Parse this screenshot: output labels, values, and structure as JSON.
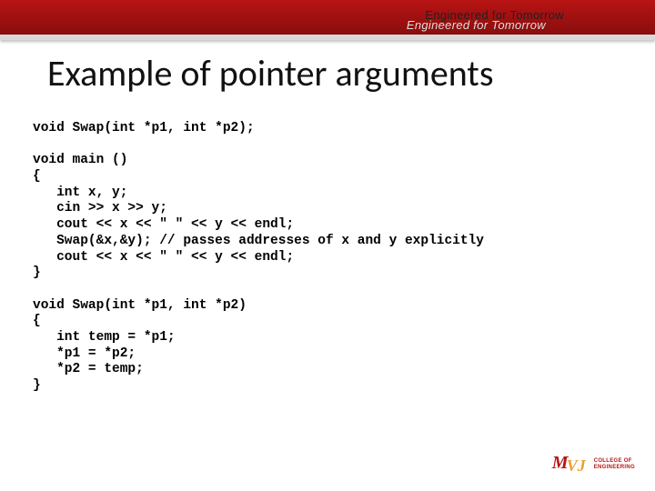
{
  "header": {
    "tagline": "Engineered for Tomorrow",
    "ghost_tagline": "Engineered for Tomorrow"
  },
  "slide": {
    "title": "Example of pointer arguments"
  },
  "code": {
    "line1": "void Swap(int *p1, int *p2);",
    "blank1": "",
    "line2": "void main ()",
    "line3": "{",
    "line4": "   int x, y;",
    "line5": "   cin >> x >> y;",
    "line6": "   cout << x << \" \" << y << endl;",
    "line7": "   Swap(&x,&y); // passes addresses of x and y explicitly",
    "line8": "   cout << x << \" \" << y << endl;",
    "line9": "}",
    "blank2": "",
    "line10": "void Swap(int *p1, int *p2)",
    "line11": "{",
    "line12": "   int temp = *p1;",
    "line13": "   *p1 = *p2;",
    "line14": "   *p2 = temp;",
    "line15": "}"
  },
  "logo": {
    "line1": "College of",
    "line2": "Engineering"
  }
}
